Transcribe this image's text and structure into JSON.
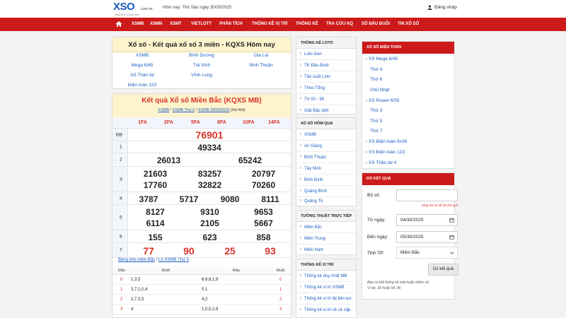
{
  "header": {
    "logo_word": "XSO",
    "logo_domain": ".com.vn",
    "logo_tagline": "Nhanh & Chính xác",
    "today_text": "Hôm nay: Thứ Sáu ngày 30/05/2025",
    "login_label": "Đăng nhập"
  },
  "nav": [
    "XSMB",
    "XSMN",
    "XSMT",
    "VIETLOTT",
    "PHÂN TÍCH",
    "THỐNG KÊ VỊ TRÍ",
    "THỐNG KÊ",
    "TRA CỨU KQ",
    "SỐ ĐẦU ĐUÔI",
    "TIN XỔ SỐ"
  ],
  "quick": {
    "title": "Xổ số - Kết quả xổ số 3 miền - KQXS Hôm nay",
    "links": [
      "XSMB",
      "Bình Dương",
      "Gia Lai",
      "Mega 6/45",
      "Trà Vinh",
      "Ninh Thuận",
      "XS Thần tài",
      "Vĩnh Long",
      "",
      "Điện toán 123"
    ]
  },
  "result": {
    "title": "Kết quả Xổ số Miền Bắc (KQXS MB)",
    "crumb1": "XSMB",
    "crumb2": "XSMB Thứ 5",
    "crumb3": "XSMB 29/05/2025",
    "crumb_tail": "(Hà Nội)",
    "codes": [
      "1FA",
      "2FA",
      "5FA",
      "8FA",
      "10FA",
      "14FA"
    ],
    "labels": [
      "ĐB",
      "1",
      "2",
      "3",
      "4",
      "5",
      "6",
      "7"
    ],
    "db": "76901",
    "g1": "49334",
    "g2": [
      "26013",
      "65242"
    ],
    "g3": [
      "21603",
      "83257",
      "20797",
      "17760",
      "32822",
      "70260"
    ],
    "g4": [
      "3787",
      "5717",
      "9080",
      "8111"
    ],
    "g5": [
      "8127",
      "9310",
      "9653",
      "6114",
      "2105",
      "5667"
    ],
    "g6": [
      "155",
      "623",
      "858"
    ],
    "g7": [
      "77",
      "90",
      "25",
      "93"
    ]
  },
  "loto": {
    "link1": "Bảng loto miền Bắc",
    "link2": "Lô XSMB Thứ 5",
    "headers": [
      "Đầu",
      "Đuôi",
      "Đầu",
      "Đuôi"
    ],
    "rows": [
      {
        "d": "0",
        "duoi": "1,3,5",
        "tail_vals": "6,6,8,1,9",
        "d2": "0"
      },
      {
        "d": "1",
        "duoi": "3,7,1,0,4",
        "tail_vals": "0,1",
        "d2": "1"
      },
      {
        "d": "2",
        "duoi": "2,7,3,5",
        "tail_vals": "4,2",
        "d2": "2"
      },
      {
        "d": "3",
        "duoi": "4",
        "tail_vals": "1,0,5,2,9",
        "d2": "3"
      }
    ]
  },
  "mid": {
    "loto_title": "THỐNG KÊ LOTO",
    "loto_items": [
      "Loto Gan",
      "TK Đầu-Đuôi",
      "Tần suất Loto",
      "Theo Tổng",
      "Từ 00 - 99",
      "Giải Đặc biệt"
    ],
    "yesterday_title": "XỔ SỐ HÔM QUA",
    "yesterday_items": [
      "XSMB",
      "An Giang",
      "Bình Thuận",
      "Tây Ninh",
      "Bình Định",
      "Quảng Bình",
      "Quảng Trị"
    ],
    "live_title": "TƯỜNG THUẬT TRỰC TIẾP",
    "live_items": [
      "Miền Bắc",
      "Miền Trung",
      "Miền Nam"
    ],
    "pos_title": "THỐNG KÊ VỊ TRÍ",
    "pos_items": [
      "Thống kê duy nhất MB",
      "Thống kê vị trí XSMB",
      "Thống kê vị trí lật liên tục",
      "Thống kê vị trí về cả cặp"
    ]
  },
  "right": {
    "dt_title": "XỔ SỐ ĐIỆN TOÁN",
    "dt_items": [
      "XS Mega 6/45",
      "Thứ 4",
      "Thứ 6",
      "Chủ Nhật",
      "XS Power 6/55",
      "Thứ 3",
      "Thứ 5",
      "Thứ 7",
      "XS Điện toán 6x36",
      "XS Điện toán 123",
      "XS Thần tài 4"
    ],
    "check_title": "DÒ KẾT QUẢ",
    "boso_label": "Bộ số:",
    "boso_hint": "Nhập bộ số để dò kết quả",
    "from_label": "Từ ngày:",
    "from_value": "04/30/2025",
    "to_label": "Đến ngày:",
    "to_value": "05/30/2025",
    "province_label": "Tỉnh TP:",
    "province_value": "Miền Bắc",
    "submit_label": "Dò kết quả",
    "help1": "Bạn có thể thống kê một hoặc nhiều số.",
    "help2": "Ví dụ: 36 hoặc 68, 86"
  }
}
